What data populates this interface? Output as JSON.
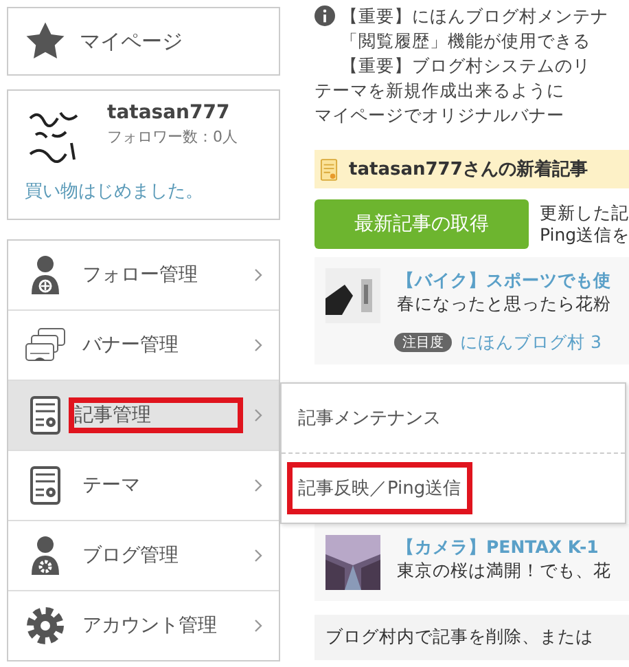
{
  "mypage": {
    "label": "マイページ"
  },
  "profile": {
    "name": "tatasan777",
    "followers": "フォロワー数：0人",
    "blog_title": "買い物はじめました。"
  },
  "menu": [
    {
      "kind": "follow",
      "label": "フォロー管理",
      "selected": false,
      "highlighted": false
    },
    {
      "kind": "banner",
      "label": "バナー管理",
      "selected": false,
      "highlighted": false
    },
    {
      "kind": "post",
      "label": "記事管理",
      "selected": true,
      "highlighted": true
    },
    {
      "kind": "theme",
      "label": "テーマ",
      "selected": false,
      "highlighted": false
    },
    {
      "kind": "blog",
      "label": "ブログ管理",
      "selected": false,
      "highlighted": false
    },
    {
      "kind": "account",
      "label": "アカウント管理",
      "selected": false,
      "highlighted": false
    }
  ],
  "submenu": [
    {
      "label": "記事メンテナンス",
      "highlighted": false
    },
    {
      "label": "記事反映／Ping送信",
      "highlighted": true
    }
  ],
  "notices": [
    "【重要】にほんブログ村メンテナ",
    "「閲覧履歴」機能が使用できる",
    "【重要】ブログ村システムのリ",
    "テーマを新規作成出来るように",
    "マイページでオリジナルバナー"
  ],
  "new_posts": {
    "title": "tatasan777さんの新着記事",
    "button": "最新記事の取得",
    "note": [
      "更新した記",
      "Ping送信を"
    ],
    "articles": [
      {
        "title": "【バイク】スポーツでも使",
        "excerpt": "春になったと思ったら花粉",
        "tag": "注目度",
        "link": "にほんブログ村 3"
      },
      {
        "title": "【カメラ】PENTAX K-1",
        "excerpt": "東京の桜は満開！でも、花"
      }
    ],
    "footer": "ブログ村内で記事を削除、または"
  }
}
